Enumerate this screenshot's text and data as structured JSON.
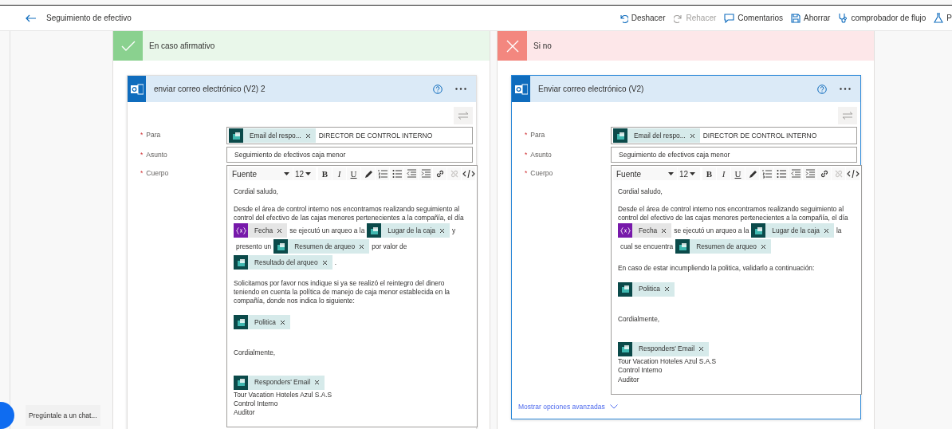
{
  "top_bar": {
    "title": "Seguimiento de efectivo",
    "actions": [
      {
        "kind": "undo",
        "label": "Deshacer",
        "disabled": false
      },
      {
        "kind": "redo",
        "label": "Rehacer",
        "disabled": true
      },
      {
        "kind": "comments",
        "label": "Comentarios",
        "disabled": false
      },
      {
        "kind": "save",
        "label": "Ahorrar",
        "disabled": false
      },
      {
        "kind": "checker",
        "label": "comprobador de flujo",
        "disabled": false
      },
      {
        "kind": "test",
        "label": "P",
        "disabled": false
      }
    ]
  },
  "branches": [
    {
      "kind": "yes",
      "title": "En caso afirmativo",
      "card": {
        "title": "enviar correo electrónico (V2) 2",
        "selected": false,
        "fields": [
          {
            "kind": "recipients",
            "label": "Para",
            "required_mark": "*",
            "tokens": [
              {
                "kind": "dataverse",
                "label": "Email del respo..."
              }
            ],
            "value": "DIRECTOR DE CONTROL INTERNO"
          },
          {
            "kind": "text",
            "label": "Asunto",
            "required_mark": "*",
            "value": "Seguimiento de efectivos caja menor"
          },
          {
            "kind": "rich",
            "label": "Cuerpo",
            "required_mark": "*",
            "toolbar": {
              "font": "Fuente",
              "size": "12",
              "buttons": [
                {
                  "kind": "bold",
                  "label": "B",
                  "disabled": false
                },
                {
                  "kind": "italic",
                  "label": "I",
                  "disabled": false
                },
                {
                  "kind": "underline",
                  "label": "U",
                  "disabled": false
                },
                {
                  "kind": "pen",
                  "disabled": false
                },
                {
                  "kind": "numbered",
                  "disabled": false
                },
                {
                  "kind": "bullets",
                  "disabled": false
                },
                {
                  "kind": "outdent",
                  "disabled": false
                },
                {
                  "kind": "indent",
                  "disabled": false
                },
                {
                  "kind": "link",
                  "disabled": false
                },
                {
                  "kind": "unlink",
                  "disabled": true
                },
                {
                  "kind": "code",
                  "disabled": false
                }
              ]
            },
            "blocks": [
              {
                "kind": "paragraph",
                "parts": [
                  {
                    "kind": "text",
                    "text": "Cordial saludo,"
                  }
                ]
              },
              {
                "kind": "paragraph",
                "parts": [
                  {
                    "kind": "text",
                    "text": "Desde el área de control interno nos encontramos realizando seguimiento al control del efectivo de las cajas menores pertenecientes a la compañía, el día"
                  },
                  {
                    "kind": "variable",
                    "label": "Fecha"
                  },
                  {
                    "kind": "text",
                    "text": "se ejecutó un arqueo a la"
                  },
                  {
                    "kind": "dataverse",
                    "label": "Lugar de la caja"
                  },
                  {
                    "kind": "text",
                    "text": "y"
                  },
                  {
                    "kind": "text",
                    "text": "presento un"
                  },
                  {
                    "kind": "dataverse",
                    "label": "Resumen de arqueo"
                  },
                  {
                    "kind": "text",
                    "text": "por valor de"
                  },
                  {
                    "kind": "dataverse",
                    "label": "Resultado del arqueo"
                  },
                  {
                    "kind": "text",
                    "text": "."
                  }
                ]
              },
              {
                "kind": "paragraph",
                "parts": [
                  {
                    "kind": "text",
                    "text": "Solicitamos por favor nos indique si ya se realizó el reintegro del dinero teniendo en cuenta la política de manejo de caja menor establecida en la compañía, donde nos indica lo siguiente:"
                  }
                ]
              },
              {
                "kind": "spaced",
                "parts": [
                  {
                    "kind": "dataverse",
                    "label": "Politica"
                  }
                ]
              },
              {
                "kind": "spaced",
                "parts": [
                  {
                    "kind": "text",
                    "text": "Cordialmente,"
                  }
                ]
              },
              {
                "kind": "line",
                "parts": [
                  {
                    "kind": "dataverse",
                    "label": "Responders' Email"
                  }
                ]
              },
              {
                "kind": "line",
                "parts": [
                  {
                    "kind": "text",
                    "text": "Tour Vacation Hoteles Azul S.A.S"
                  }
                ]
              },
              {
                "kind": "line",
                "parts": [
                  {
                    "kind": "text",
                    "text": "Control Interno"
                  }
                ]
              },
              {
                "kind": "line",
                "parts": [
                  {
                    "kind": "text",
                    "text": "Auditor"
                  }
                ]
              }
            ]
          }
        ]
      }
    },
    {
      "kind": "no",
      "title": "Si no",
      "card": {
        "title": "Enviar correo electrónico (V2)",
        "selected": true,
        "advanced_link": "Mostrar opciones avanzadas",
        "fields": [
          {
            "kind": "recipients",
            "label": "Para",
            "required_mark": "*",
            "tokens": [
              {
                "kind": "dataverse",
                "label": "Email del respo..."
              }
            ],
            "value": "DIRECTOR DE CONTROL INTERNO"
          },
          {
            "kind": "text",
            "label": "Asunto",
            "required_mark": "*",
            "value": "Seguimiento de efectivos caja menor"
          },
          {
            "kind": "rich",
            "label": "Cuerpo",
            "required_mark": "*",
            "toolbar": {
              "font": "Fuente",
              "size": "12",
              "buttons": [
                {
                  "kind": "bold",
                  "label": "B",
                  "disabled": false
                },
                {
                  "kind": "italic",
                  "label": "I",
                  "disabled": false
                },
                {
                  "kind": "underline",
                  "label": "U",
                  "disabled": false
                },
                {
                  "kind": "pen",
                  "disabled": false
                },
                {
                  "kind": "numbered",
                  "disabled": false
                },
                {
                  "kind": "bullets",
                  "disabled": false
                },
                {
                  "kind": "outdent",
                  "disabled": false
                },
                {
                  "kind": "indent",
                  "disabled": false
                },
                {
                  "kind": "link",
                  "disabled": false
                },
                {
                  "kind": "unlink",
                  "disabled": true
                },
                {
                  "kind": "code",
                  "disabled": false
                }
              ]
            },
            "blocks": [
              {
                "kind": "paragraph",
                "parts": [
                  {
                    "kind": "text",
                    "text": "Cordial saludo,"
                  }
                ]
              },
              {
                "kind": "paragraph",
                "parts": [
                  {
                    "kind": "text",
                    "text": "Desde el área de control interno nos encontramos realizando seguimiento al control del efectivo de las cajas menores pertenecientes a la compañía, el día"
                  },
                  {
                    "kind": "variable",
                    "label": "Fecha"
                  },
                  {
                    "kind": "text",
                    "text": "se ejecutó un arqueo a la"
                  },
                  {
                    "kind": "dataverse",
                    "label": "Lugar de la caja"
                  },
                  {
                    "kind": "text",
                    "text": "la"
                  },
                  {
                    "kind": "text",
                    "text": "cual se encuentra"
                  },
                  {
                    "kind": "dataverse",
                    "label": "Resumen de arqueo"
                  }
                ]
              },
              {
                "kind": "paragraph",
                "parts": [
                  {
                    "kind": "text",
                    "text": "En caso de estar incumpliendo la politica, validarlo a continuación:"
                  }
                ]
              },
              {
                "kind": "spaced",
                "parts": [
                  {
                    "kind": "dataverse",
                    "label": "Politica"
                  }
                ]
              },
              {
                "kind": "spaced",
                "parts": [
                  {
                    "kind": "text",
                    "text": "Cordialmente,"
                  }
                ]
              },
              {
                "kind": "line",
                "parts": [
                  {
                    "kind": "dataverse",
                    "label": "Responders' Email"
                  }
                ]
              },
              {
                "kind": "line",
                "parts": [
                  {
                    "kind": "text",
                    "text": "Tour Vacation Hoteles Azul S.A.S"
                  }
                ]
              },
              {
                "kind": "line",
                "parts": [
                  {
                    "kind": "text",
                    "text": "Control Interno"
                  }
                ]
              },
              {
                "kind": "line",
                "parts": [
                  {
                    "kind": "text",
                    "text": "Auditor"
                  }
                ]
              }
            ]
          }
        ]
      }
    }
  ],
  "chat": {
    "placeholder": "Pregúntale a un chat..."
  }
}
